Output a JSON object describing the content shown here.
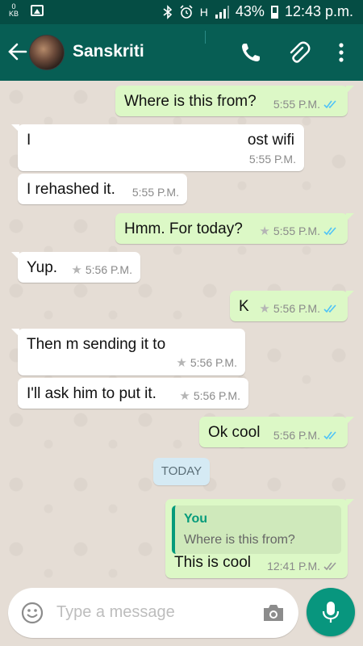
{
  "status_bar": {
    "kb_count": "0",
    "kb_unit": "KB",
    "signal_label": "H",
    "battery": "43%",
    "time": "12:43 p.m."
  },
  "app_bar": {
    "contact_name": "Sanskriti"
  },
  "messages": [
    {
      "text": "Where is this from?",
      "time": "5:55 P.M."
    },
    {
      "text_left": "I",
      "text_right": "ost wifi",
      "time": "5:55 P.M."
    },
    {
      "text": "I rehashed it.",
      "time": "5:55 P.M."
    },
    {
      "text": "Hmm. For today?",
      "time": "5:55 P.M."
    },
    {
      "text": "Yup.",
      "time": "5:56 P.M."
    },
    {
      "text": "K",
      "time": "5:56 P.M."
    },
    {
      "text": "Then m sending it to",
      "time": "5:56 P.M."
    },
    {
      "text": "I'll ask him to put it.",
      "time": "5:56 P.M."
    },
    {
      "text": "Ok cool",
      "time": "5:56 P.M."
    },
    {
      "text": "This is cool",
      "time": "12:41 P.M.",
      "quote_name": "You",
      "quote_text": "Where is this from?"
    }
  ],
  "date_divider": "TODAY",
  "input": {
    "placeholder": "Type a message"
  },
  "colors": {
    "header": "#075e54",
    "status_bar": "#054d44",
    "outgoing_bubble": "#dcf8c6",
    "incoming_bubble": "#ffffff",
    "read_ticks": "#4fc3f7",
    "accent": "#08967e"
  }
}
